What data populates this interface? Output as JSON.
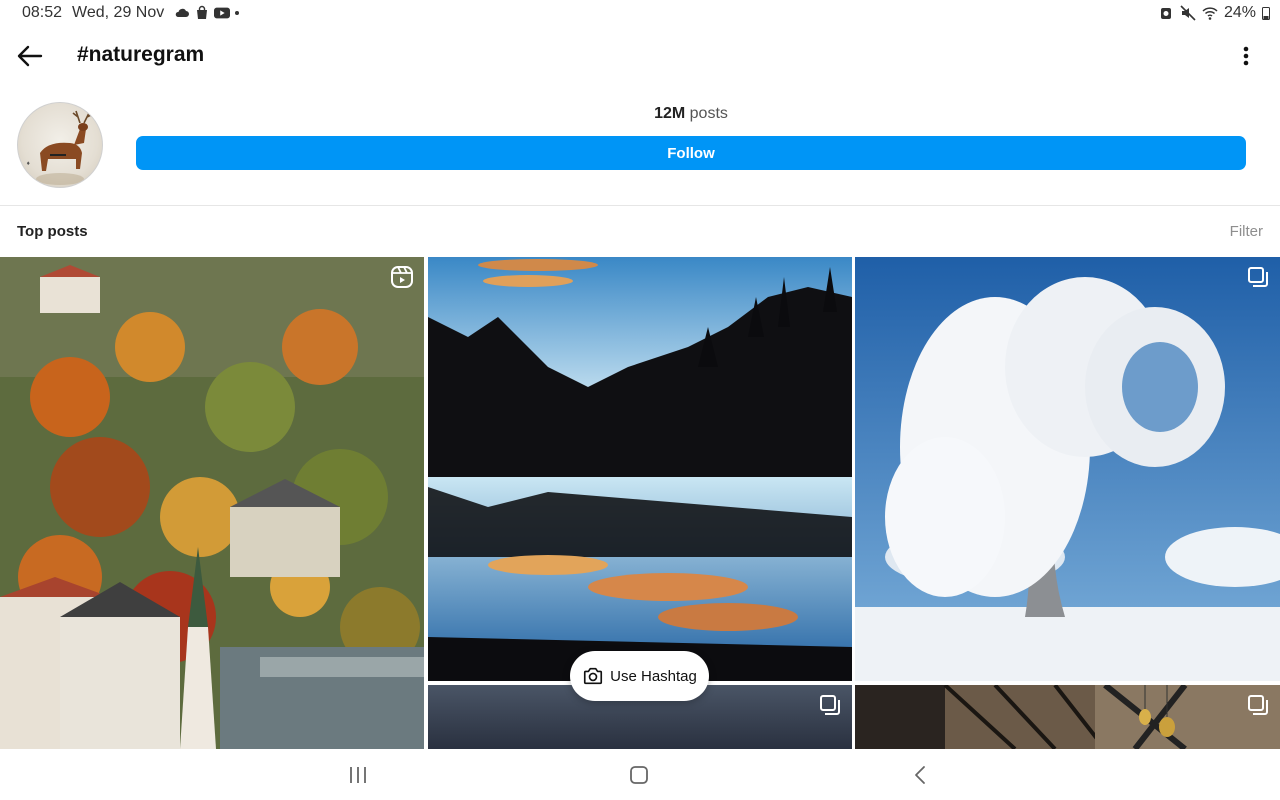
{
  "status_bar": {
    "time": "08:52",
    "date": "Wed, 29 Nov",
    "battery": "24%",
    "icons_left": [
      "cloud-icon",
      "bag-icon",
      "youtube-icon",
      "dot-icon"
    ],
    "icons_right": [
      "alarm-icon",
      "mute-icon",
      "wifi-icon",
      "battery-icon"
    ]
  },
  "header": {
    "title": "#naturegram",
    "back_icon": "arrow-left-icon",
    "menu_icon": "more-vertical-icon"
  },
  "profile": {
    "posts_count": "12M",
    "posts_label": "posts",
    "follow_label": "Follow",
    "follow_color": "#0095f6"
  },
  "section": {
    "title": "Top posts",
    "filter_label": "Filter"
  },
  "posts": [
    {
      "subject": "autumn town aerial",
      "badge": "reels-icon"
    },
    {
      "subject": "mountain lake reflection",
      "badge": ""
    },
    {
      "subject": "frosted white tree",
      "badge": "carousel-icon"
    },
    {
      "subject": "dark blue gradient",
      "badge": "carousel-icon"
    },
    {
      "subject": "interior with hanging lamps",
      "badge": "carousel-icon"
    }
  ],
  "overlay": {
    "use_hashtag_label": "Use Hashtag",
    "icon": "camera-icon"
  },
  "nav": {
    "items": [
      "recent-apps-icon",
      "home-icon",
      "back-icon"
    ]
  }
}
